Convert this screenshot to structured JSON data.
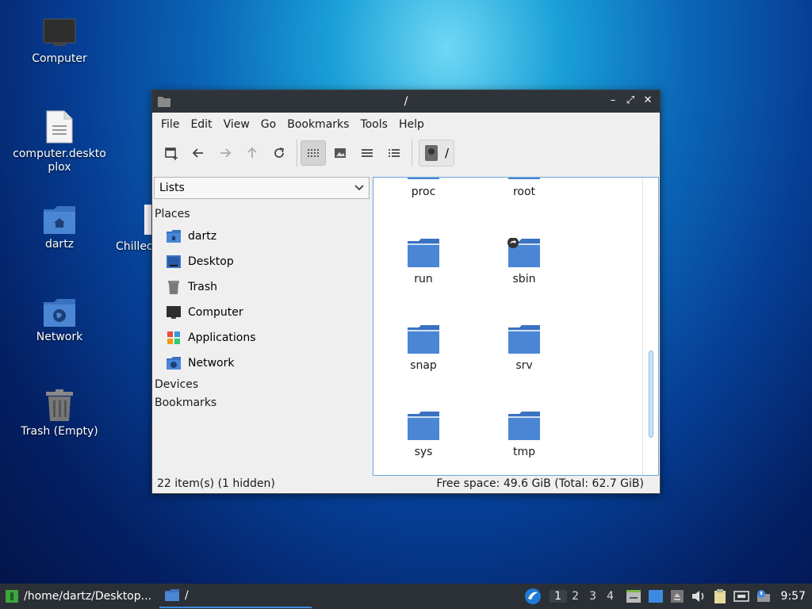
{
  "desktop": {
    "icons": [
      {
        "label": "Computer"
      },
      {
        "label": "computer.desktoplox",
        "line1": "computer.deskto",
        "line2": "plox"
      },
      {
        "label": "dartz"
      },
      {
        "label": "Chillec"
      },
      {
        "label": "Network"
      },
      {
        "label": "Trash (Empty)"
      }
    ]
  },
  "window": {
    "title": "/",
    "menu": [
      "File",
      "Edit",
      "View",
      "Go",
      "Bookmarks",
      "Tools",
      "Help"
    ],
    "path": "/",
    "sidebar": {
      "mode": "Lists",
      "sections": {
        "places": "Places",
        "devices": "Devices",
        "bookmarks": "Bookmarks"
      },
      "places": [
        "dartz",
        "Desktop",
        "Trash",
        "Computer",
        "Applications",
        "Network"
      ]
    },
    "files": [
      "proc",
      "root",
      "run",
      "sbin",
      "snap",
      "srv",
      "sys",
      "tmp"
    ],
    "status": {
      "left": "22 item(s) (1 hidden)",
      "right": "Free space: 49.6 GiB (Total: 62.7 GiB)"
    }
  },
  "taskbar": {
    "tasks": [
      {
        "label": "/home/dartz/Desktop..."
      },
      {
        "label": "/"
      }
    ],
    "workspaces": [
      "1",
      "2",
      "3",
      "4"
    ],
    "clock": "9:57"
  },
  "colors": {
    "folder": "#4a86d4",
    "accent": "#3d8be0",
    "titlebar": "#2f343a"
  }
}
